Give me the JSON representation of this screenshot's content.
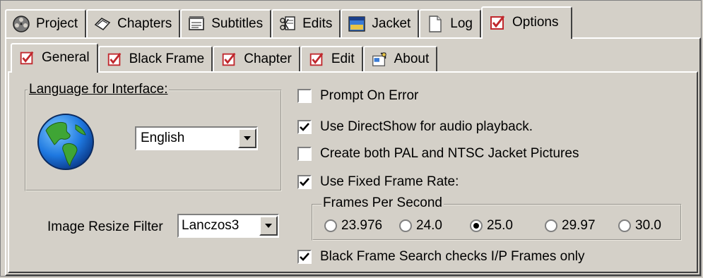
{
  "top_tabs": [
    {
      "label": "Project",
      "icon": "film-reel-icon",
      "active": false
    },
    {
      "label": "Chapters",
      "icon": "chapters-icon",
      "active": false
    },
    {
      "label": "Subtitles",
      "icon": "subtitles-icon",
      "active": false
    },
    {
      "label": "Edits",
      "icon": "edits-icon",
      "active": false
    },
    {
      "label": "Jacket",
      "icon": "jacket-icon",
      "active": false
    },
    {
      "label": "Log",
      "icon": "document-icon",
      "active": false
    },
    {
      "label": "Options",
      "icon": "checked-box-icon",
      "active": true
    }
  ],
  "sub_tabs": [
    {
      "label": "General",
      "icon": "checked-box-icon",
      "active": true
    },
    {
      "label": "Black Frame",
      "icon": "checked-box-icon",
      "active": false
    },
    {
      "label": "Chapter",
      "icon": "checked-box-icon",
      "active": false
    },
    {
      "label": "Edit",
      "icon": "checked-box-icon",
      "active": false
    },
    {
      "label": "About",
      "icon": "about-icon",
      "active": false
    }
  ],
  "language": {
    "group_label": "Language for Interface:",
    "icon": "globe-icon",
    "selected": "English"
  },
  "resize_filter": {
    "label": "Image Resize Filter",
    "selected": "Lanczos3"
  },
  "options": [
    {
      "label": "Prompt On Error",
      "checked": false
    },
    {
      "label": "Use DirectShow for audio playback.",
      "checked": true
    },
    {
      "label": "Create both PAL and NTSC Jacket Pictures",
      "checked": false
    },
    {
      "label": "Use Fixed Frame Rate:",
      "checked": true
    }
  ],
  "fps": {
    "group_label": "Frames Per Second",
    "choices": [
      "23.976",
      "24.0",
      "25.0",
      "29.97",
      "30.0"
    ],
    "selected": "25.0"
  },
  "black_frame_option": {
    "label": "Black Frame Search checks I/P Frames only",
    "checked": true
  },
  "colors": {
    "face": "#d4d0c8",
    "check_red": "#c0282d",
    "highlight": "#ffffff",
    "shadow": "#404040"
  }
}
